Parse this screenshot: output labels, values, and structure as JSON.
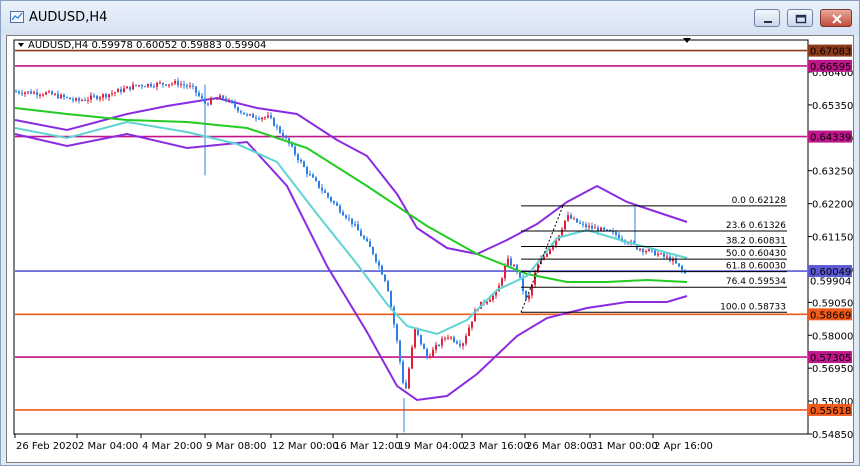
{
  "window": {
    "title": "AUDUSD,H4",
    "buttons": [
      "minimize",
      "maximize",
      "close"
    ]
  },
  "chart": {
    "symbol_line": "AUDUSD,H4  0.59978 0.60052 0.59883 0.59904",
    "price_scale": [
      "0.66400",
      "0.65350",
      "0.64300",
      "0.63250",
      "0.62200",
      "0.61150",
      "0.60100",
      "0.59050",
      "0.58000",
      "0.56950",
      "0.55900",
      "0.54850"
    ],
    "time_scale": [
      "26 Feb 2020",
      "2 Mar 04:00",
      "4 Mar 20:00",
      "9 Mar 08:00",
      "12 Mar 00:00",
      "16 Mar 12:00",
      "19 Mar 04:00",
      "23 Mar 16:00",
      "26 Mar 08:00",
      "31 Mar 00:00",
      "2 Apr 16:00"
    ],
    "horizontal_levels": [
      {
        "price": "0.67083",
        "color": "#8b3a1a"
      },
      {
        "price": "0.66595",
        "color": "#c0168c"
      },
      {
        "price": "0.64339",
        "color": "#c0168c"
      },
      {
        "price": "0.60049",
        "color": "#5b5bd6"
      },
      {
        "price": "0.58669",
        "color": "#f05a1a"
      },
      {
        "price": "0.57305",
        "color": "#c0168c"
      },
      {
        "price": "0.55618",
        "color": "#f05a1a"
      }
    ],
    "fibonacci": [
      {
        "label": "0.0 0.62128"
      },
      {
        "label": "23.6 0.61326"
      },
      {
        "label": "38.2 0.60831"
      },
      {
        "label": "50.0 0.60430"
      },
      {
        "label": "61.8 0.60030"
      },
      {
        "label": "76.4 0.59534"
      },
      {
        "label": "100.0 0.58733"
      }
    ],
    "extra_scale_label": "0.59904",
    "colors": {
      "bull": "#e0203a",
      "bear": "#2d7fe6",
      "ma_green": "#22cc22",
      "ma_cyan": "#5fd4d4",
      "bands": "#8a2be2"
    }
  }
}
